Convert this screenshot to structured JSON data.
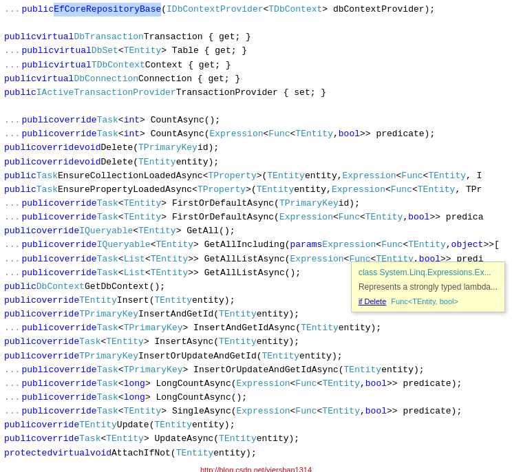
{
  "lines": [
    {
      "id": 1,
      "dots": "...",
      "segments": [
        {
          "text": "public ",
          "class": "kw-blue"
        },
        {
          "text": "EfCoreRepositoryBase",
          "class": "kw-highlight"
        },
        {
          "text": "("
        },
        {
          "text": "IDbContextProvider",
          "class": "kw-teal"
        },
        {
          "text": "<"
        },
        {
          "text": "TDbContext",
          "class": "kw-teal"
        },
        {
          "text": "> dbContextProvider);"
        }
      ]
    },
    {
      "id": 2,
      "dots": "",
      "segments": []
    },
    {
      "id": 3,
      "dots": "",
      "segments": [
        {
          "text": "public ",
          "class": "kw-blue"
        },
        {
          "text": "virtual ",
          "class": "kw-blue"
        },
        {
          "text": "DbTransaction",
          "class": "kw-teal"
        },
        {
          "text": " Transaction { get; }"
        }
      ]
    },
    {
      "id": 4,
      "dots": "...",
      "segments": [
        {
          "text": "public ",
          "class": "kw-blue"
        },
        {
          "text": "virtual ",
          "class": "kw-blue"
        },
        {
          "text": "DbSet",
          "class": "kw-teal"
        },
        {
          "text": "<"
        },
        {
          "text": "TEntity",
          "class": "kw-teal"
        },
        {
          "text": "> Table { get; }"
        }
      ]
    },
    {
      "id": 5,
      "dots": "...",
      "segments": [
        {
          "text": "public ",
          "class": "kw-blue"
        },
        {
          "text": "virtual ",
          "class": "kw-blue"
        },
        {
          "text": "TDbContext",
          "class": "kw-teal"
        },
        {
          "text": " Context { get; }"
        }
      ]
    },
    {
      "id": 6,
      "dots": "",
      "segments": [
        {
          "text": "public ",
          "class": "kw-blue"
        },
        {
          "text": "virtual ",
          "class": "kw-blue"
        },
        {
          "text": "DbConnection",
          "class": "kw-teal"
        },
        {
          "text": " Connection { get; }"
        }
      ]
    },
    {
      "id": 7,
      "dots": "",
      "segments": [
        {
          "text": "public ",
          "class": "kw-blue"
        },
        {
          "text": "IActiveTransactionProvider",
          "class": "kw-teal"
        },
        {
          "text": " TransactionProvider { set; }"
        }
      ]
    },
    {
      "id": 8,
      "dots": "",
      "segments": []
    },
    {
      "id": 9,
      "dots": "...",
      "segments": [
        {
          "text": "public ",
          "class": "kw-blue"
        },
        {
          "text": "override ",
          "class": "kw-blue"
        },
        {
          "text": "Task",
          "class": "kw-teal"
        },
        {
          "text": "<"
        },
        {
          "text": "int",
          "class": "kw-blue"
        },
        {
          "text": "> CountAsync();"
        }
      ]
    },
    {
      "id": 10,
      "dots": "...",
      "segments": [
        {
          "text": "public ",
          "class": "kw-blue"
        },
        {
          "text": "override ",
          "class": "kw-blue"
        },
        {
          "text": "Task",
          "class": "kw-teal"
        },
        {
          "text": "<"
        },
        {
          "text": "int",
          "class": "kw-blue"
        },
        {
          "text": "> CountAsync("
        },
        {
          "text": "Expression",
          "class": "kw-teal"
        },
        {
          "text": "<"
        },
        {
          "text": "Func",
          "class": "kw-teal"
        },
        {
          "text": "<"
        },
        {
          "text": "TEntity",
          "class": "kw-teal"
        },
        {
          "text": ", "
        },
        {
          "text": "bool",
          "class": "kw-blue"
        },
        {
          "text": ">> predicate);"
        }
      ]
    },
    {
      "id": 11,
      "dots": "",
      "segments": [
        {
          "text": "public ",
          "class": "kw-blue"
        },
        {
          "text": "override ",
          "class": "kw-blue"
        },
        {
          "text": "void ",
          "class": "kw-blue"
        },
        {
          "text": "Delete("
        },
        {
          "text": "TPrimaryKey",
          "class": "kw-teal"
        },
        {
          "text": " id);"
        }
      ]
    },
    {
      "id": 12,
      "dots": "",
      "segments": [
        {
          "text": "public ",
          "class": "kw-blue"
        },
        {
          "text": "override ",
          "class": "kw-blue"
        },
        {
          "text": "void ",
          "class": "kw-blue"
        },
        {
          "text": "Delete("
        },
        {
          "text": "TEntity",
          "class": "kw-teal"
        },
        {
          "text": " entity);"
        }
      ]
    },
    {
      "id": 13,
      "dots": "",
      "segments": [
        {
          "text": "public ",
          "class": "kw-blue"
        },
        {
          "text": "Task",
          "class": "kw-teal"
        },
        {
          "text": " EnsureCollectionLoadedAsync<"
        },
        {
          "text": "TProperty",
          "class": "kw-teal"
        },
        {
          "text": ">("
        },
        {
          "text": "TEntity",
          "class": "kw-teal"
        },
        {
          "text": " entity, "
        },
        {
          "text": "Expression",
          "class": "kw-teal"
        },
        {
          "text": "<"
        },
        {
          "text": "Func",
          "class": "kw-teal"
        },
        {
          "text": "<"
        },
        {
          "text": "TEntity",
          "class": "kw-teal"
        },
        {
          "text": ", I"
        }
      ]
    },
    {
      "id": 14,
      "dots": "",
      "segments": [
        {
          "text": "public ",
          "class": "kw-blue"
        },
        {
          "text": "Task",
          "class": "kw-teal"
        },
        {
          "text": " EnsurePropertyLoadedAsync<"
        },
        {
          "text": "TProperty",
          "class": "kw-teal"
        },
        {
          "text": ">("
        },
        {
          "text": "TEntity",
          "class": "kw-teal"
        },
        {
          "text": " entity, "
        },
        {
          "text": "Expression",
          "class": "kw-teal"
        },
        {
          "text": "<"
        },
        {
          "text": "Func",
          "class": "kw-teal"
        },
        {
          "text": "<"
        },
        {
          "text": "TEntity",
          "class": "kw-teal"
        },
        {
          "text": ", TPr"
        }
      ]
    },
    {
      "id": 15,
      "dots": "...",
      "segments": [
        {
          "text": "public ",
          "class": "kw-blue"
        },
        {
          "text": "override ",
          "class": "kw-blue"
        },
        {
          "text": "Task",
          "class": "kw-teal"
        },
        {
          "text": "<"
        },
        {
          "text": "TEntity",
          "class": "kw-teal"
        },
        {
          "text": "> FirstOrDefaultAsync("
        },
        {
          "text": "TPrimaryKey",
          "class": "kw-teal"
        },
        {
          "text": " id);"
        }
      ]
    },
    {
      "id": 16,
      "dots": "...",
      "segments": [
        {
          "text": "public ",
          "class": "kw-blue"
        },
        {
          "text": "override ",
          "class": "kw-blue"
        },
        {
          "text": "Task",
          "class": "kw-teal"
        },
        {
          "text": "<"
        },
        {
          "text": "TEntity",
          "class": "kw-teal"
        },
        {
          "text": "> FirstOrDefaultAsync("
        },
        {
          "text": "Expression",
          "class": "kw-teal"
        },
        {
          "text": "<"
        },
        {
          "text": "Func",
          "class": "kw-teal"
        },
        {
          "text": "<"
        },
        {
          "text": "TEntity",
          "class": "kw-teal"
        },
        {
          "text": ", "
        },
        {
          "text": "bool",
          "class": "kw-blue"
        },
        {
          "text": ">> predica"
        }
      ]
    },
    {
      "id": 17,
      "dots": "",
      "segments": [
        {
          "text": "public ",
          "class": "kw-blue"
        },
        {
          "text": "override ",
          "class": "kw-blue"
        },
        {
          "text": "IQueryable",
          "class": "kw-teal"
        },
        {
          "text": "<"
        },
        {
          "text": "TEntity",
          "class": "kw-teal"
        },
        {
          "text": "> GetAll();"
        }
      ]
    },
    {
      "id": 18,
      "dots": "...",
      "segments": [
        {
          "text": "public ",
          "class": "kw-blue"
        },
        {
          "text": "override ",
          "class": "kw-blue"
        },
        {
          "text": "IQueryable",
          "class": "kw-teal"
        },
        {
          "text": "<"
        },
        {
          "text": "TEntity",
          "class": "kw-teal"
        },
        {
          "text": "> GetAllIncluding("
        },
        {
          "text": "params ",
          "class": "kw-blue"
        },
        {
          "text": "Expression",
          "class": "kw-teal"
        },
        {
          "text": "<"
        },
        {
          "text": "Func",
          "class": "kw-teal"
        },
        {
          "text": "<"
        },
        {
          "text": "TEntity",
          "class": "kw-teal"
        },
        {
          "text": ", "
        },
        {
          "text": "object",
          "class": "kw-blue"
        },
        {
          "text": ">>["
        }
      ]
    },
    {
      "id": 19,
      "dots": "...",
      "segments": [
        {
          "text": "public ",
          "class": "kw-blue"
        },
        {
          "text": "override ",
          "class": "kw-blue"
        },
        {
          "text": "Task",
          "class": "kw-teal"
        },
        {
          "text": "<"
        },
        {
          "text": "List",
          "class": "kw-teal"
        },
        {
          "text": "<"
        },
        {
          "text": "TEntity",
          "class": "kw-teal"
        },
        {
          "text": ">> GetAllListAsync("
        },
        {
          "text": "Expression",
          "class": "kw-teal"
        },
        {
          "text": "<"
        },
        {
          "text": "Func",
          "class": "kw-teal"
        },
        {
          "text": "<"
        },
        {
          "text": "TEntity",
          "class": "kw-teal"
        },
        {
          "text": ", "
        },
        {
          "text": "bool",
          "class": "kw-blue"
        },
        {
          "text": ">> predi"
        }
      ]
    },
    {
      "id": 20,
      "dots": "...",
      "segments": [
        {
          "text": "public ",
          "class": "kw-blue"
        },
        {
          "text": "override ",
          "class": "kw-blue"
        },
        {
          "text": "Task",
          "class": "kw-teal"
        },
        {
          "text": "<"
        },
        {
          "text": "List",
          "class": "kw-teal"
        },
        {
          "text": "<"
        },
        {
          "text": "TEntity",
          "class": "kw-teal"
        },
        {
          "text": ">> GetAllListAsync();"
        }
      ]
    },
    {
      "id": 21,
      "dots": "",
      "segments": [
        {
          "text": "public ",
          "class": "kw-blue"
        },
        {
          "text": "DbContext",
          "class": "kw-teal"
        },
        {
          "text": " GetDbContext();"
        }
      ]
    },
    {
      "id": 22,
      "dots": "",
      "segments": [
        {
          "text": "public ",
          "class": "kw-blue"
        },
        {
          "text": "override ",
          "class": "kw-blue"
        },
        {
          "text": "TEntity",
          "class": "kw-teal"
        },
        {
          "text": " Insert("
        },
        {
          "text": "TEntity",
          "class": "kw-teal"
        },
        {
          "text": " entity);"
        }
      ]
    },
    {
      "id": 23,
      "dots": "",
      "segments": [
        {
          "text": "public ",
          "class": "kw-blue"
        },
        {
          "text": "override ",
          "class": "kw-blue"
        },
        {
          "text": "TPrimaryKey",
          "class": "kw-teal"
        },
        {
          "text": " InsertAndGetId("
        },
        {
          "text": "TEntity",
          "class": "kw-teal"
        },
        {
          "text": " entity);"
        }
      ]
    },
    {
      "id": 24,
      "dots": "...",
      "segments": [
        {
          "text": "public ",
          "class": "kw-blue"
        },
        {
          "text": "override ",
          "class": "kw-blue"
        },
        {
          "text": "Task",
          "class": "kw-teal"
        },
        {
          "text": "<"
        },
        {
          "text": "TPrimaryKey",
          "class": "kw-teal"
        },
        {
          "text": "> InsertAndGetIdAsync("
        },
        {
          "text": "TEntity",
          "class": "kw-teal"
        },
        {
          "text": " entity);"
        }
      ]
    },
    {
      "id": 25,
      "dots": "",
      "segments": [
        {
          "text": "public ",
          "class": "kw-blue"
        },
        {
          "text": "override ",
          "class": "kw-blue"
        },
        {
          "text": "Task",
          "class": "kw-teal"
        },
        {
          "text": "<"
        },
        {
          "text": "TEntity",
          "class": "kw-teal"
        },
        {
          "text": "> InsertAsync("
        },
        {
          "text": "TEntity",
          "class": "kw-teal"
        },
        {
          "text": " entity);"
        }
      ]
    },
    {
      "id": 26,
      "dots": "",
      "segments": [
        {
          "text": "public ",
          "class": "kw-blue"
        },
        {
          "text": "override ",
          "class": "kw-blue"
        },
        {
          "text": "TPrimaryKey",
          "class": "kw-teal"
        },
        {
          "text": " InsertOrUpdateAndGetId("
        },
        {
          "text": "TEntity",
          "class": "kw-teal"
        },
        {
          "text": " entity);"
        }
      ]
    },
    {
      "id": 27,
      "dots": "...",
      "segments": [
        {
          "text": "public ",
          "class": "kw-blue"
        },
        {
          "text": "override ",
          "class": "kw-blue"
        },
        {
          "text": "Task",
          "class": "kw-teal"
        },
        {
          "text": "<"
        },
        {
          "text": "TPrimaryKey",
          "class": "kw-teal"
        },
        {
          "text": "> InsertOrUpdateAndGetIdAsync("
        },
        {
          "text": "TEntity",
          "class": "kw-teal"
        },
        {
          "text": " entity);"
        }
      ]
    },
    {
      "id": 28,
      "dots": "...",
      "segments": [
        {
          "text": "public ",
          "class": "kw-blue"
        },
        {
          "text": "override ",
          "class": "kw-blue"
        },
        {
          "text": "Task",
          "class": "kw-teal"
        },
        {
          "text": "<"
        },
        {
          "text": "long",
          "class": "kw-blue"
        },
        {
          "text": "> LongCountAsync("
        },
        {
          "text": "Expression",
          "class": "kw-teal"
        },
        {
          "text": "<"
        },
        {
          "text": "Func",
          "class": "kw-teal"
        },
        {
          "text": "<"
        },
        {
          "text": "TEntity",
          "class": "kw-teal"
        },
        {
          "text": ", "
        },
        {
          "text": "bool",
          "class": "kw-blue"
        },
        {
          "text": ">> predicate);"
        }
      ]
    },
    {
      "id": 29,
      "dots": "...",
      "segments": [
        {
          "text": "public ",
          "class": "kw-blue"
        },
        {
          "text": "override ",
          "class": "kw-blue"
        },
        {
          "text": "Task",
          "class": "kw-teal"
        },
        {
          "text": "<"
        },
        {
          "text": "long",
          "class": "kw-blue"
        },
        {
          "text": "> LongCountAsync();"
        }
      ]
    },
    {
      "id": 30,
      "dots": "...",
      "segments": [
        {
          "text": "public ",
          "class": "kw-blue"
        },
        {
          "text": "override ",
          "class": "kw-blue"
        },
        {
          "text": "Task",
          "class": "kw-teal"
        },
        {
          "text": "<"
        },
        {
          "text": "TEntity",
          "class": "kw-teal"
        },
        {
          "text": "> SingleAsync("
        },
        {
          "text": "Expression",
          "class": "kw-teal"
        },
        {
          "text": "<"
        },
        {
          "text": "Func",
          "class": "kw-teal"
        },
        {
          "text": "<"
        },
        {
          "text": "TEntity",
          "class": "kw-teal"
        },
        {
          "text": ", "
        },
        {
          "text": "bool",
          "class": "kw-blue"
        },
        {
          "text": ">> predicate);"
        }
      ]
    },
    {
      "id": 31,
      "dots": "",
      "segments": [
        {
          "text": "public ",
          "class": "kw-blue"
        },
        {
          "text": "override ",
          "class": "kw-blue"
        },
        {
          "text": "TEntity",
          "class": "kw-teal"
        },
        {
          "text": " Update("
        },
        {
          "text": "TEntity",
          "class": "kw-teal"
        },
        {
          "text": " entity);"
        }
      ]
    },
    {
      "id": 32,
      "dots": "",
      "segments": [
        {
          "text": "public ",
          "class": "kw-blue"
        },
        {
          "text": "override ",
          "class": "kw-blue"
        },
        {
          "text": "Task",
          "class": "kw-teal"
        },
        {
          "text": "<"
        },
        {
          "text": "TEntity",
          "class": "kw-teal"
        },
        {
          "text": "> UpdateAsync("
        },
        {
          "text": "TEntity",
          "class": "kw-teal"
        },
        {
          "text": " entity);"
        }
      ]
    },
    {
      "id": 33,
      "dots": "",
      "segments": [
        {
          "text": "protected ",
          "class": "kw-blue"
        },
        {
          "text": "virtual ",
          "class": "kw-blue"
        },
        {
          "text": "void ",
          "class": "kw-blue"
        },
        {
          "text": "AttachIfNot("
        },
        {
          "text": "TEntity",
          "class": "kw-teal"
        },
        {
          "text": " entity);"
        }
      ]
    }
  ],
  "tooltip": {
    "title": "class System.Linq.Expressions.Ex...",
    "description": "Represents a strongly typed lambda..."
  },
  "tooltip_extra": {
    "text": "if Delete",
    "suffix": "Func<TEntity, bool>"
  },
  "watermark": {
    "text": "http://blog.csdn.net/yiershan1314"
  }
}
